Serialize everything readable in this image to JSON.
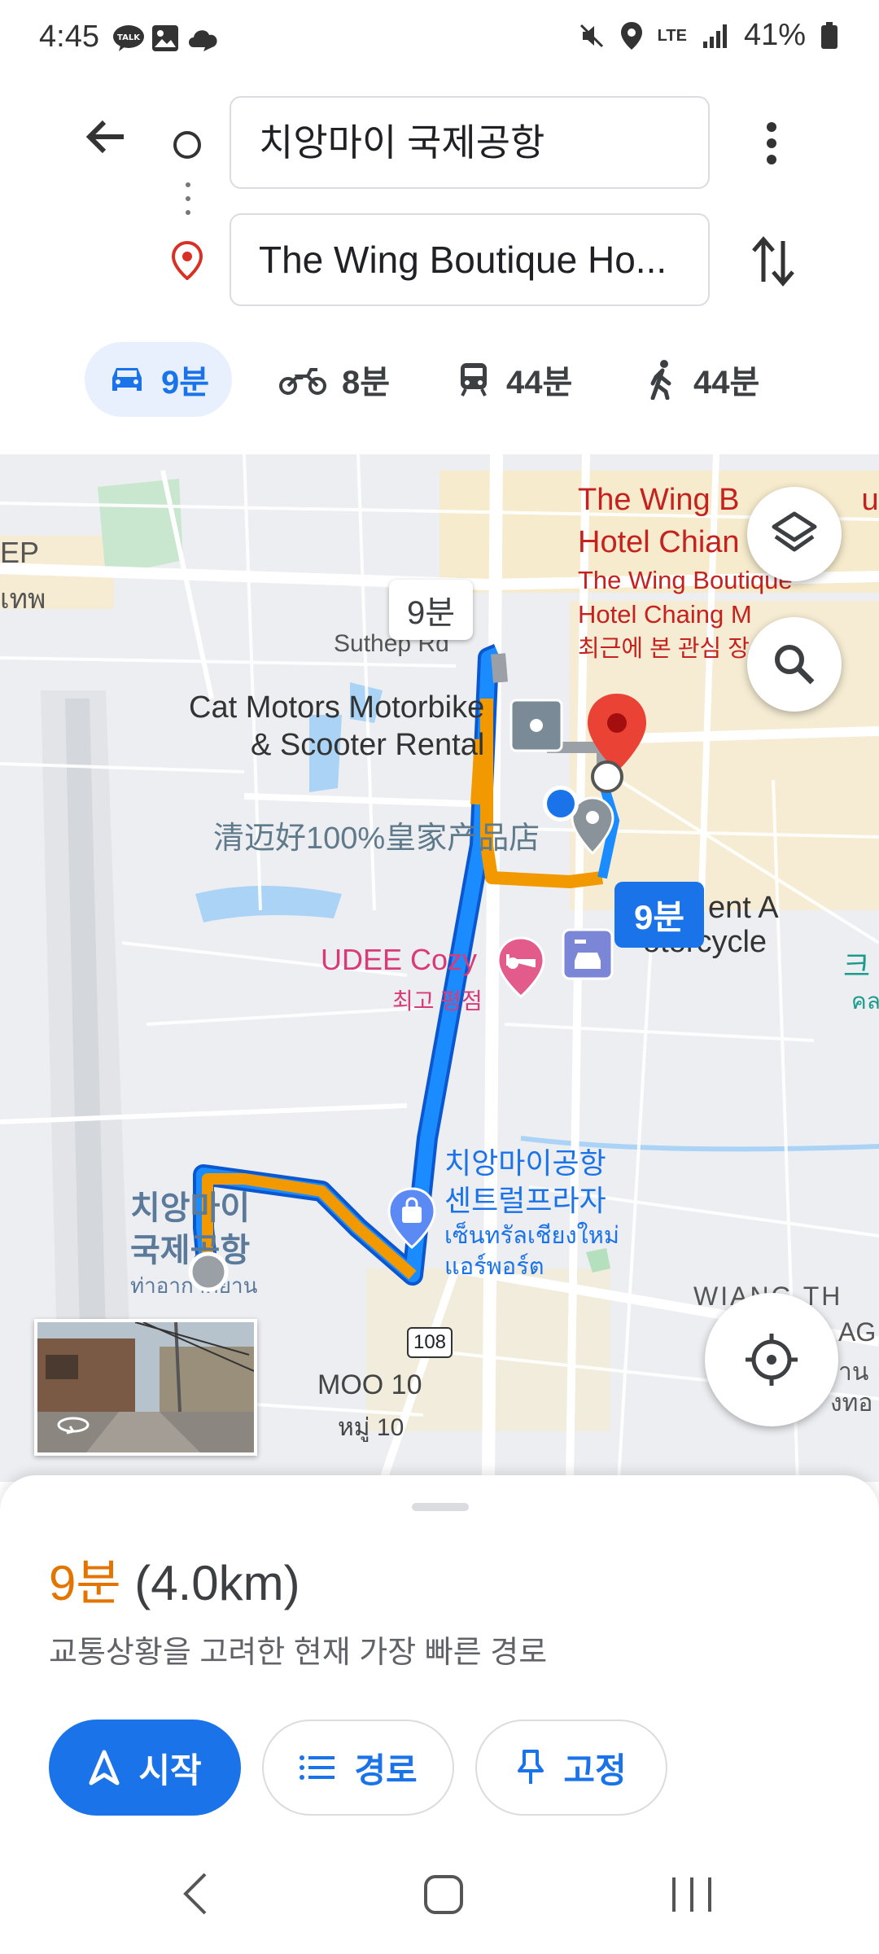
{
  "status_bar": {
    "time": "4:45",
    "battery": "41%",
    "network": "LTE"
  },
  "route": {
    "origin": "치앙마이 국제공항",
    "destination": "The Wing Boutique Ho..."
  },
  "modes": [
    {
      "icon": "car-icon",
      "label": "9분",
      "active": true
    },
    {
      "icon": "motorcycle-icon",
      "label": "8분",
      "active": false
    },
    {
      "icon": "transit-icon",
      "label": "44분",
      "active": false
    },
    {
      "icon": "walk-icon",
      "label": "44분",
      "active": false
    }
  ],
  "map": {
    "route_time_top": "9분",
    "route_time_bubble": "9분",
    "labels": {
      "hotel_name_1": "The Wing B",
      "hotel_name_1b": "ue",
      "hotel_name_2": "Hotel Chian",
      "hotel_sub_1": "The Wing Boutique",
      "hotel_sub_2": "Hotel Chaing M",
      "hotel_recent": "최근에 본 관심 장",
      "suthep_rd": "Suthep Rd",
      "cat_motors_1": "Cat Motors Motorbike",
      "cat_motors_2": "& Scooter Rental",
      "chinese_shop": "清迈好100%皇家产品店",
      "rent_1": "ent A",
      "rent_2": "otorcycle",
      "udee": "UDEE Cozy",
      "udee_sub": "최고 평점",
      "central_1": "치앙마이공항",
      "central_2": "센트럴프라자",
      "central_th_1": "เซ็นทรัลเชียงใหม่",
      "central_th_2": "แอร์พอร์ต",
      "airport_1": "치앙마이",
      "airport_2": "국제공항",
      "airport_th": "ท่าอากาศยาน",
      "road_108": "108",
      "moo10": "MOO 10",
      "moo10_th": "หมู่ 10",
      "wiang_1": "WIANG TH",
      "wiang_2": "AG",
      "wiang_th_1": "าน",
      "wiang_th_2": "งทอ",
      "ep": "EP",
      "thai_edge": "เทพ",
      "right_edge_1": "크",
      "right_edge_2": "คล"
    }
  },
  "summary": {
    "duration": "9분",
    "distance": "(4.0km)",
    "description": "교통상황을 고려한 현재 가장 빠른 경로"
  },
  "actions": {
    "start": "시작",
    "steps": "경로",
    "pin": "고정"
  },
  "colors": {
    "accent": "#1a73e8",
    "route_blue": "#1a8cff",
    "traffic_orange": "#f29900",
    "duration_orange": "#e37400",
    "hotel_red": "#c5221f",
    "poi_pink": "#d93b78"
  }
}
